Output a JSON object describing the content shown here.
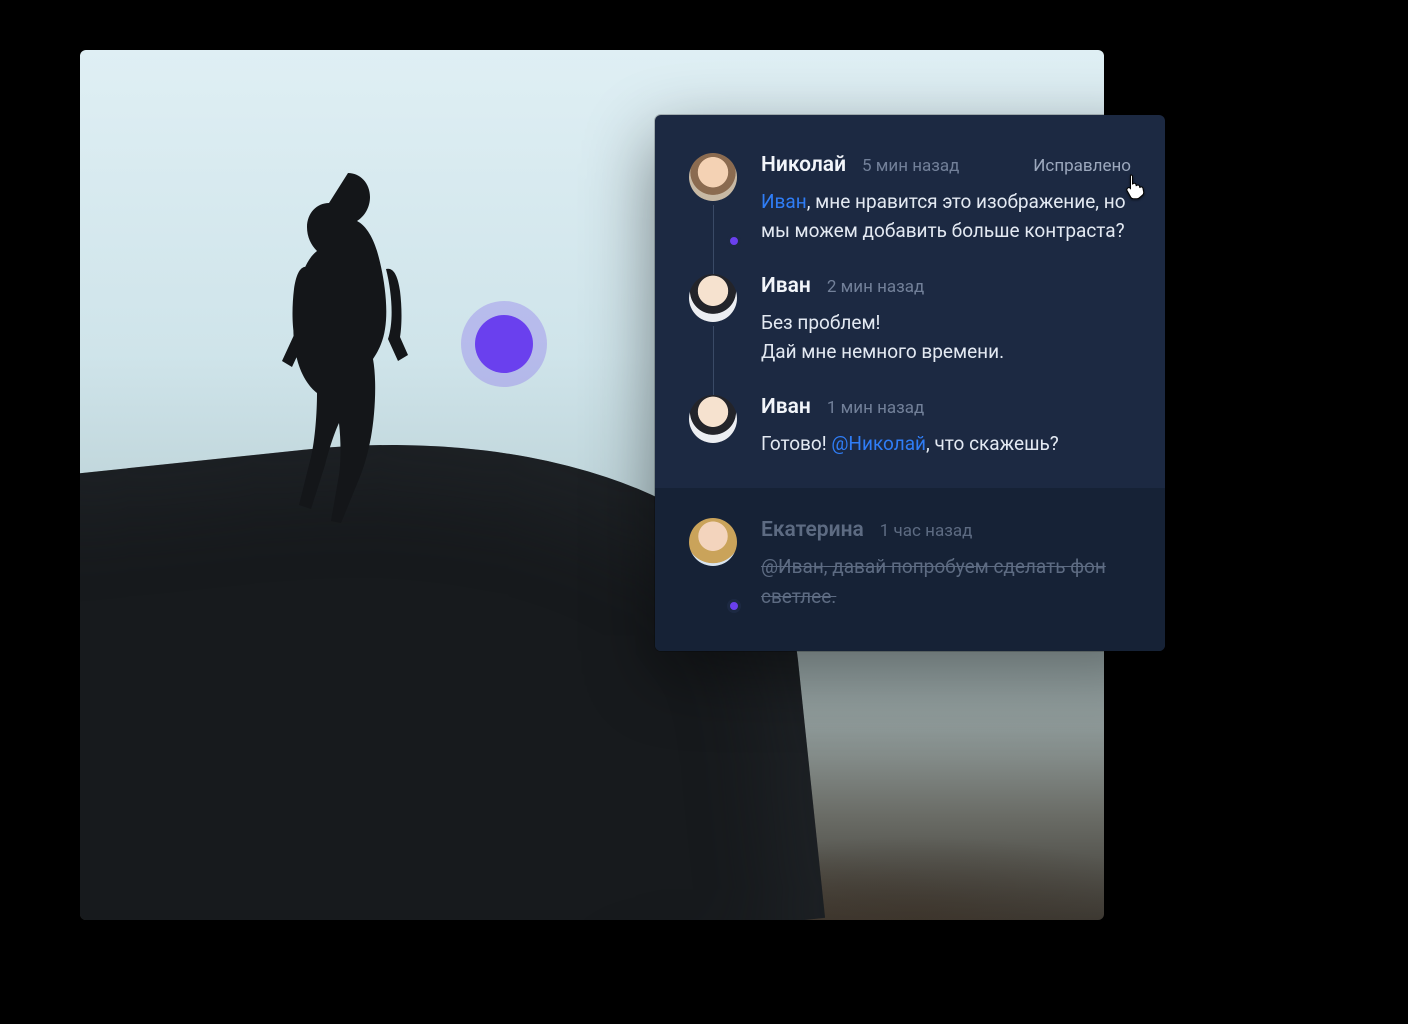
{
  "annotation": {
    "color": "#6a40ee"
  },
  "panel": {
    "resolved_label": "Исправлено",
    "comments": [
      {
        "name": "Николай",
        "time": "5 мин назад",
        "presence": true,
        "text_pre_mention": "",
        "mention": "Иван",
        "text_post_mention": ", мне нравится это изображение, но мы можем добавить больше контраста?"
      },
      {
        "name": "Иван",
        "time": "2 мин назад",
        "line1": "Без проблем!",
        "line2": "Дай мне немного времени."
      },
      {
        "name": "Иван",
        "time": "1 мин назад",
        "text_pre_mention": "Готово! ",
        "mention": "@Николай",
        "text_post_mention": ", что скажешь?"
      }
    ],
    "resolved": {
      "name": "Екатерина",
      "time": "1 час назад",
      "mention": "@Иван",
      "text_post_mention": ", давай попробуем сделать фон светлее."
    }
  }
}
